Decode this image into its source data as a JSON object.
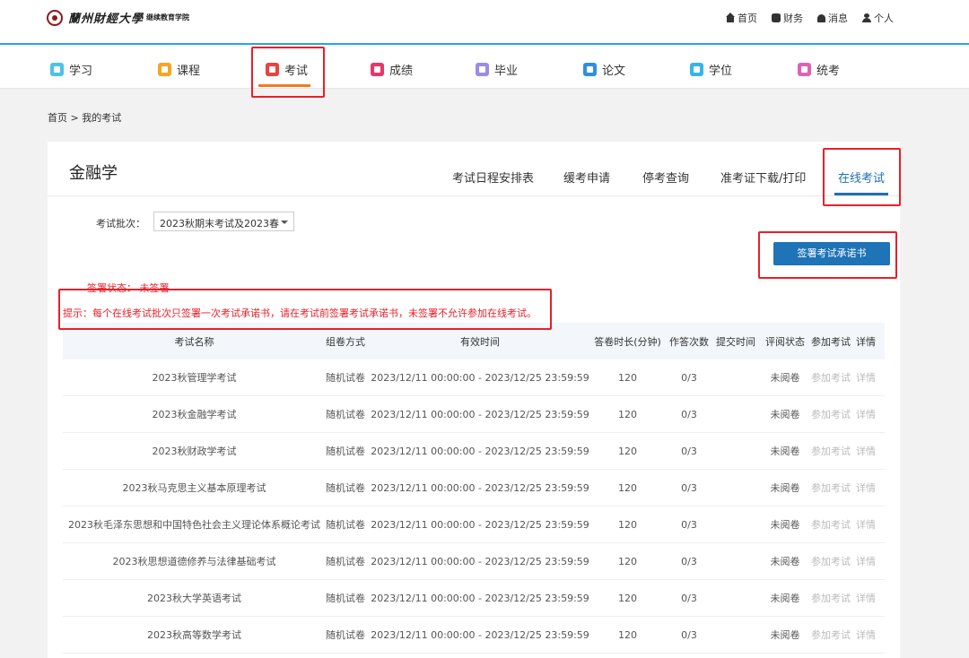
{
  "header": {
    "logo_name": "蘭州財經大學",
    "logo_sub": "继续教育学院",
    "links": [
      "首页",
      "财务",
      "消息",
      "个人"
    ]
  },
  "nav": {
    "items": [
      {
        "label": "学习",
        "icon": "study-icon",
        "color": "#4cc3e6"
      },
      {
        "label": "课程",
        "icon": "course-icon",
        "color": "#f5a623"
      },
      {
        "label": "考试",
        "icon": "exam-icon",
        "color": "#e8433f"
      },
      {
        "label": "成绩",
        "icon": "score-icon",
        "color": "#e8356b"
      },
      {
        "label": "毕业",
        "icon": "graduation-icon",
        "color": "#9a8ce8"
      },
      {
        "label": "论文",
        "icon": "thesis-icon",
        "color": "#2f8fe0"
      },
      {
        "label": "学位",
        "icon": "degree-icon",
        "color": "#36b5e8"
      },
      {
        "label": "统考",
        "icon": "unified-exam-icon",
        "color": "#e060b8"
      }
    ],
    "active": "考试",
    "accent": "#f07c22"
  },
  "breadcrumb": "首页 > 我的考试",
  "card": {
    "title": "金融学",
    "tabs": [
      "考试日程安排表",
      "缓考申请",
      "停考查询",
      "准考证下载/打印",
      "在线考试"
    ],
    "active_tab": "在线考试",
    "batch_label": "考试批次：",
    "batch_value": "2023秋期末考试及2023春",
    "sign_button": "签署考试承诺书",
    "sign_status": "签署状态：  未签署",
    "tip": "提示：每个在线考试批次只签署一次考试承诺书，请在考试前签署考试承诺书，未签署不允许参加在线考试。"
  },
  "table": {
    "headers": [
      "考试名称",
      "组卷方式",
      "有效时间",
      "答卷时长(分钟)",
      "作答次数",
      "提交时间",
      "评阅状态",
      "参加考试",
      "详情"
    ],
    "rows": [
      {
        "name": "2023秋管理学考试",
        "method": "随机试卷",
        "time": "2023/12/11 00:00:00 - 2023/12/25 23:59:59",
        "duration": "120",
        "attempts": "0/3",
        "submit": "",
        "status": "未阅卷",
        "join": "参加考试",
        "detail": "详情"
      },
      {
        "name": "2023秋金融学考试",
        "method": "随机试卷",
        "time": "2023/12/11 00:00:00 - 2023/12/25 23:59:59",
        "duration": "120",
        "attempts": "0/3",
        "submit": "",
        "status": "未阅卷",
        "join": "参加考试",
        "detail": "详情"
      },
      {
        "name": "2023秋财政学考试",
        "method": "随机试卷",
        "time": "2023/12/11 00:00:00 - 2023/12/25 23:59:59",
        "duration": "120",
        "attempts": "0/3",
        "submit": "",
        "status": "未阅卷",
        "join": "参加考试",
        "detail": "详情"
      },
      {
        "name": "2023秋马克思主义基本原理考试",
        "method": "随机试卷",
        "time": "2023/12/11 00:00:00 - 2023/12/25 23:59:59",
        "duration": "120",
        "attempts": "0/3",
        "submit": "",
        "status": "未阅卷",
        "join": "参加考试",
        "detail": "详情"
      },
      {
        "name": "2023秋毛泽东思想和中国特色社会主义理论体系概论考试",
        "method": "随机试卷",
        "time": "2023/12/11 00:00:00 - 2023/12/25 23:59:59",
        "duration": "120",
        "attempts": "0/3",
        "submit": "",
        "status": "未阅卷",
        "join": "参加考试",
        "detail": "详情"
      },
      {
        "name": "2023秋思想道德修养与法律基础考试",
        "method": "随机试卷",
        "time": "2023/12/11 00:00:00 - 2023/12/25 23:59:59",
        "duration": "120",
        "attempts": "0/3",
        "submit": "",
        "status": "未阅卷",
        "join": "参加考试",
        "detail": "详情"
      },
      {
        "name": "2023秋大学英语考试",
        "method": "随机试卷",
        "time": "2023/12/11 00:00:00 - 2023/12/25 23:59:59",
        "duration": "120",
        "attempts": "0/3",
        "submit": "",
        "status": "未阅卷",
        "join": "参加考试",
        "detail": "详情"
      },
      {
        "name": "2023秋高等数学考试",
        "method": "随机试卷",
        "time": "2023/12/11 00:00:00 - 2023/12/25 23:59:59",
        "duration": "120",
        "attempts": "0/3",
        "submit": "",
        "status": "未阅卷",
        "join": "参加考试",
        "detail": "详情"
      }
    ]
  },
  "colors": {
    "header_rule": "#2aa6db",
    "tab_active": "#1f6fb3",
    "button": "#1f73b7",
    "alert": "#e8202a"
  }
}
